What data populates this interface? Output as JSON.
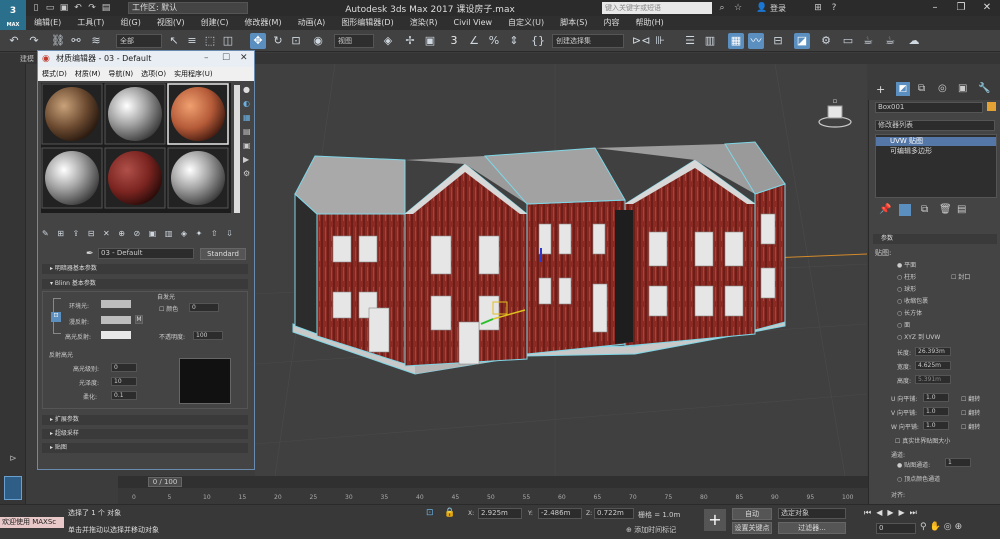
{
  "titlebar": {
    "logo": "3",
    "logo_sub": "MAX",
    "workspace": "工作区: 默认",
    "app_title": "Autodesk 3ds Max 2017     课设房子.max",
    "search_placeholder": "键入关键字或短语",
    "login": "登录"
  },
  "menubar": {
    "items": [
      "编辑(E)",
      "工具(T)",
      "组(G)",
      "视图(V)",
      "创建(C)",
      "修改器(M)",
      "动画(A)",
      "图形编辑器(D)",
      "渲染(R)",
      "Civil View",
      "自定义(U)",
      "脚本(S)",
      "内容",
      "帮助(H)"
    ]
  },
  "toolbar": {
    "filter": "全部",
    "view": "视图",
    "snap_num": "3",
    "selection_set": "创建选择集"
  },
  "ribbon": {
    "label": "建模"
  },
  "material_editor": {
    "title": "材质编辑器 - 03 - Default",
    "menu": [
      "模式(D)",
      "材质(M)",
      "导航(N)",
      "选项(O)",
      "实用程序(U)"
    ],
    "material_name": "03 - Default",
    "material_type": "Standard",
    "sections": {
      "shader_basic": "明暗器基本参数",
      "blinn_basic": "Blinn 基本参数",
      "extended": "扩展参数",
      "supersampling": "超级采样",
      "maps": "贴图"
    },
    "blinn": {
      "ambient": "环境光:",
      "diffuse": "漫反射:",
      "specular": "高光反射:",
      "self_illum": "自发光",
      "color_label": "颜色",
      "color_value": "0",
      "opacity_label": "不透明度:",
      "opacity_value": "100",
      "m_btn": "M",
      "spec_highlights": "反射高光",
      "spec_level": "高光级别:",
      "spec_level_value": "0",
      "glossiness": "光泽度:",
      "glossiness_value": "10",
      "soften": "柔化:",
      "soften_value": "0.1"
    }
  },
  "command_panel": {
    "object_name": "Box001",
    "modifier_list": "修改器列表",
    "stack": [
      "UVW 贴图",
      "可编辑多边形"
    ],
    "params_header": "参数",
    "mapping_label": "贴图:",
    "mapping_options": [
      "平面",
      "柱形",
      "球形",
      "收缩包裹",
      "长方体",
      "面",
      "XYZ 到 UVW"
    ],
    "cap_label": "封口",
    "length_label": "长度:",
    "length_value": "26.393m",
    "width_label": "宽度:",
    "width_value": "4.625m",
    "height_label": "高度:",
    "height_value": "5.391m",
    "u_tile_label": "U 向平铺:",
    "u_tile_value": "1.0",
    "v_tile_label": "V 向平铺:",
    "v_tile_value": "1.0",
    "w_tile_label": "W 向平铺:",
    "w_tile_value": "1.0",
    "flip_label": "翻转",
    "real_world": "真实世界贴图大小",
    "channel_label": "通道:",
    "map_channel": "贴图通道:",
    "map_channel_value": "1",
    "vertex_color": "顶点颜色通道",
    "align_label": "对齐:"
  },
  "timeline": {
    "frame": "0 / 100",
    "ticks": [
      "0",
      "5",
      "10",
      "15",
      "20",
      "25",
      "30",
      "35",
      "40",
      "45",
      "50",
      "55",
      "60",
      "65",
      "70",
      "75",
      "80",
      "85",
      "90",
      "95",
      "100"
    ]
  },
  "status": {
    "welcome": "欢迎使用 MAXSc",
    "selected": "选择了 1 个 对象",
    "hint": "单击并拖动以选择并移动对象",
    "x_label": "X:",
    "x_value": "2.925m",
    "y_label": "Y:",
    "y_value": "-2.486m",
    "z_label": "Z:",
    "z_value": "0.722m",
    "grid": "栅格 = 1.0m",
    "add_time_tag": "添加时间标记",
    "auto": "自动",
    "selected_obj": "选定对象",
    "set_key": "设置关键点",
    "filters": "过滤器...",
    "frame_value": "0"
  }
}
